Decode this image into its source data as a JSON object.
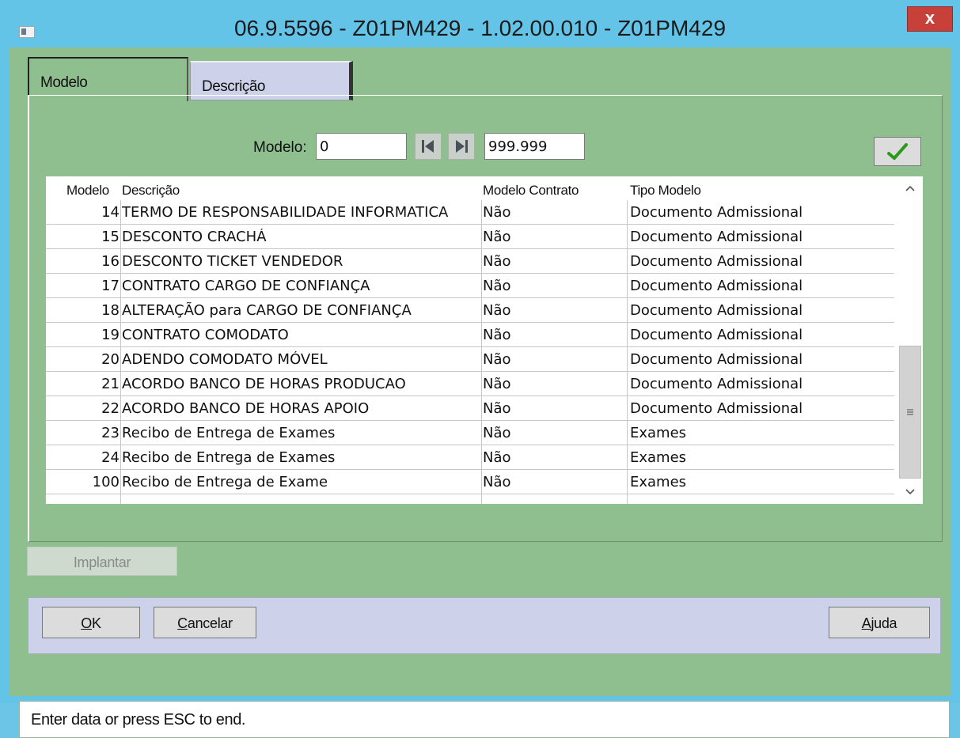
{
  "window": {
    "title": "06.9.5596 - Z01PM429 - 1.02.00.010 - Z01PM429",
    "close_label": "x"
  },
  "tabs": [
    {
      "label": "Modelo",
      "active": true
    },
    {
      "label": "Descrição",
      "active": false
    }
  ],
  "filter": {
    "label": "Modelo:",
    "from_value": "0",
    "to_value": "999.999"
  },
  "grid": {
    "headers": [
      "Modelo",
      "Descrição",
      "Modelo Contrato",
      "Tipo Modelo"
    ],
    "rows": [
      {
        "modelo": "14",
        "descricao": "TERMO DE RESPONSABILIDADE INFORMATICA",
        "contrato": "Não",
        "tipo": "Documento Admissional"
      },
      {
        "modelo": "15",
        "descricao": "DESCONTO CRACHÁ",
        "contrato": "Não",
        "tipo": "Documento Admissional"
      },
      {
        "modelo": "16",
        "descricao": "DESCONTO TICKET VENDEDOR",
        "contrato": "Não",
        "tipo": "Documento Admissional"
      },
      {
        "modelo": "17",
        "descricao": "CONTRATO CARGO DE CONFIANÇA",
        "contrato": "Não",
        "tipo": "Documento Admissional"
      },
      {
        "modelo": "18",
        "descricao": "ALTERAÇÃO para CARGO DE CONFIANÇA",
        "contrato": "Não",
        "tipo": "Documento Admissional"
      },
      {
        "modelo": "19",
        "descricao": "CONTRATO COMODATO",
        "contrato": "Não",
        "tipo": "Documento Admissional"
      },
      {
        "modelo": "20",
        "descricao": "ADENDO COMODATO MÓVEL",
        "contrato": "Não",
        "tipo": "Documento Admissional"
      },
      {
        "modelo": "21",
        "descricao": "ACORDO BANCO DE HORAS PRODUCAO",
        "contrato": "Não",
        "tipo": "Documento Admissional"
      },
      {
        "modelo": "22",
        "descricao": "ACORDO BANCO DE HORAS APOIO",
        "contrato": "Não",
        "tipo": "Documento Admissional"
      },
      {
        "modelo": "23",
        "descricao": "Recibo de Entrega de Exames",
        "contrato": "Não",
        "tipo": "Exames"
      },
      {
        "modelo": "24",
        "descricao": "Recibo de Entrega de Exames",
        "contrato": "Não",
        "tipo": "Exames"
      },
      {
        "modelo": "100",
        "descricao": "Recibo de Entrega de Exame",
        "contrato": "Não",
        "tipo": "Exames"
      }
    ]
  },
  "buttons": {
    "implantar": "Implantar",
    "ok_first": "O",
    "ok_rest": "K",
    "cancelar_first": "C",
    "cancelar_rest": "ancelar",
    "ajuda_first": "A",
    "ajuda_rest": "juda"
  },
  "status": {
    "text": "Enter data or press ESC to end."
  },
  "colors": {
    "titlebar": "#64c4e8",
    "client": "#8fbe8f",
    "tab_inactive": "#cdd2ea",
    "close_button": "#c7403a",
    "checkmark": "#2a9a1a"
  },
  "icons": [
    "window-icon",
    "close-icon",
    "first-record-icon",
    "last-record-icon",
    "confirm-check-icon",
    "scroll-up-icon",
    "scroll-down-icon",
    "scroll-grip-icon"
  ]
}
